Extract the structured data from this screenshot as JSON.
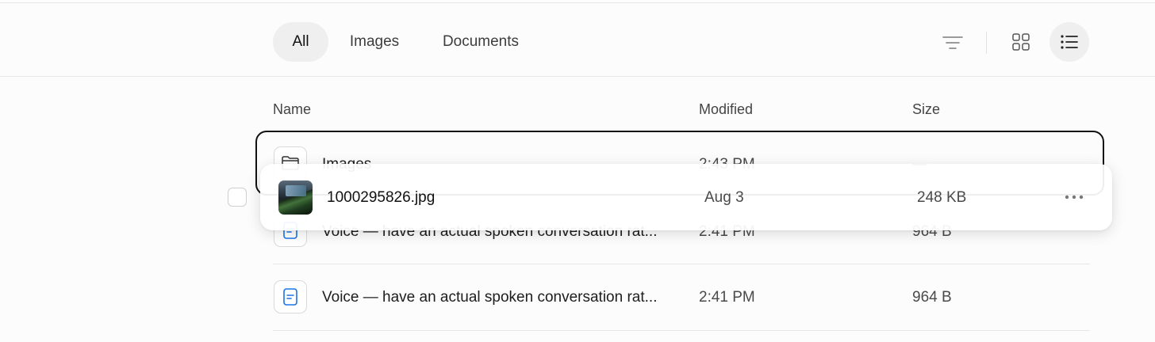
{
  "tabs": [
    {
      "label": "All",
      "active": true
    },
    {
      "label": "Images",
      "active": false
    },
    {
      "label": "Documents",
      "active": false
    }
  ],
  "toolbar_icons": [
    "filter-icon",
    "grid-view-icon",
    "list-view-icon"
  ],
  "columns": {
    "name": "Name",
    "modified": "Modified",
    "size": "Size"
  },
  "rows": [
    {
      "type": "folder",
      "name": "Images",
      "modified": "2:43 PM",
      "size": "—"
    },
    {
      "type": "document",
      "name": "Voice — have an actual spoken conversation rat...",
      "modified": "2:41 PM",
      "size": "964 B"
    },
    {
      "type": "document",
      "name": "Voice — have an actual spoken conversation rat...",
      "modified": "2:41 PM",
      "size": "964 B"
    }
  ],
  "dragging": {
    "type": "image",
    "name": "1000295826.jpg",
    "modified": "Aug 3",
    "size": "248 KB"
  },
  "colors": {
    "accent_blue": "#1a73e8",
    "selection_border": "#111111",
    "active_tab_bg": "#efefef"
  }
}
